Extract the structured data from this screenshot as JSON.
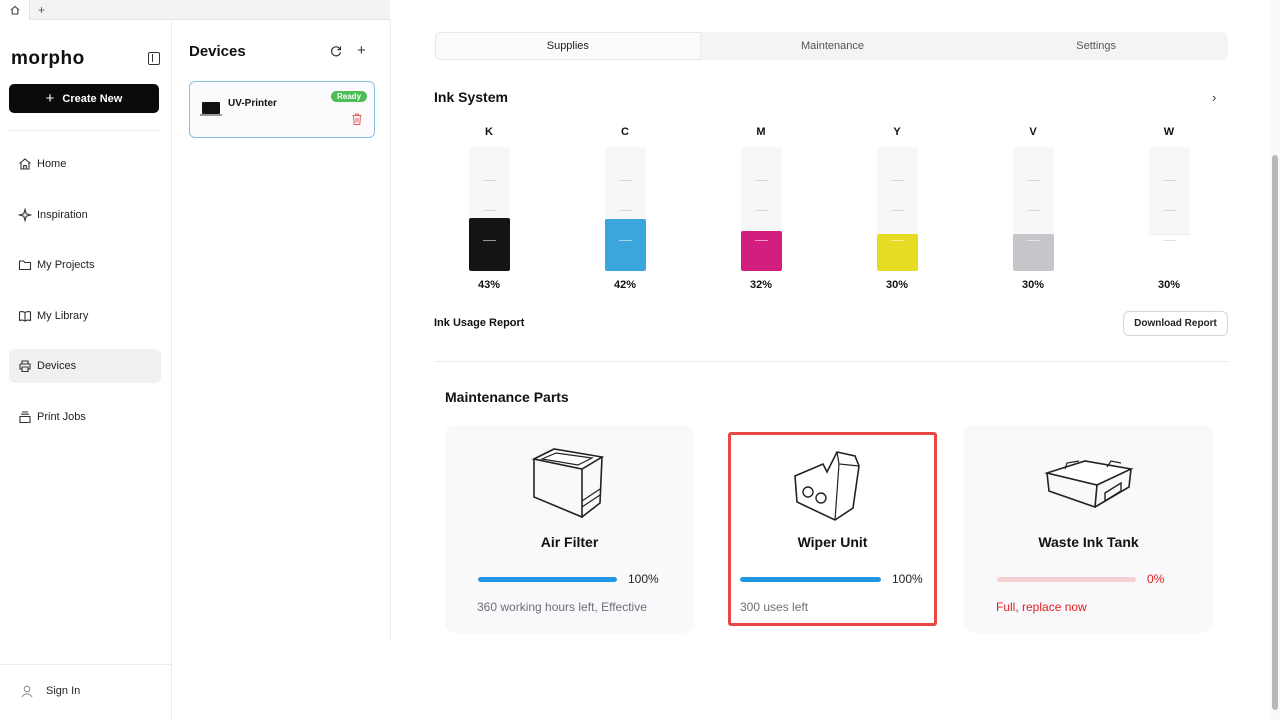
{
  "tabstrip": {
    "add_label": "+"
  },
  "sidebar": {
    "logo": "morpho",
    "create_label": "Create New",
    "items": [
      {
        "label": "Home",
        "icon": "home-icon"
      },
      {
        "label": "Inspiration",
        "icon": "sparkle-icon"
      },
      {
        "label": "My Projects",
        "icon": "folder-icon"
      },
      {
        "label": "My Library",
        "icon": "book-icon"
      },
      {
        "label": "Devices",
        "icon": "printer-icon",
        "active": true
      },
      {
        "label": "Print Jobs",
        "icon": "stack-icon"
      }
    ],
    "signin_label": "Sign In"
  },
  "devices_panel": {
    "title": "Devices",
    "add_label": "+",
    "device": {
      "name": "UV-Printer",
      "status": "Ready"
    }
  },
  "main": {
    "tabs": [
      {
        "label": "Supplies",
        "active": true
      },
      {
        "label": "Maintenance"
      },
      {
        "label": "Settings"
      }
    ],
    "ink_title": "Ink System",
    "chevron": "›",
    "inks": [
      {
        "name": "K",
        "level": 43,
        "pct": "43%",
        "color": "#141414"
      },
      {
        "name": "C",
        "level": 42,
        "pct": "42%",
        "color": "#3aa6dc"
      },
      {
        "name": "M",
        "level": 32,
        "pct": "32%",
        "color": "#d21f7f"
      },
      {
        "name": "Y",
        "level": 30,
        "pct": "30%",
        "color": "#e6dc24"
      },
      {
        "name": "V",
        "level": 30,
        "pct": "30%",
        "color": "#c4c6c9"
      },
      {
        "name": "W",
        "level": 30,
        "pct": "30%",
        "color": "#ffffff"
      }
    ],
    "usage_label": "Ink Usage Report",
    "download_label": "Download Report",
    "maintenance_title": "Maintenance Parts",
    "parts": [
      {
        "name": "Air Filter",
        "level": 100,
        "pct": "100%",
        "note": "360 working hours left, Effective",
        "bar_color": "#1e96e3",
        "status_color": "#6b6f76",
        "icon": "air-filter-icon"
      },
      {
        "name": "Wiper Unit",
        "level": 100,
        "pct": "100%",
        "note": "300 uses left",
        "bar_color": "#1e96e3",
        "status_color": "#6b6f76",
        "icon": "wiper-unit-icon",
        "highlighted": true
      },
      {
        "name": "Waste Ink Tank",
        "level": 0,
        "pct": "0%",
        "note": "Full, replace now",
        "bar_color": "#f3b4b8",
        "status_color": "#e02020",
        "icon": "waste-ink-tank-icon"
      }
    ]
  }
}
